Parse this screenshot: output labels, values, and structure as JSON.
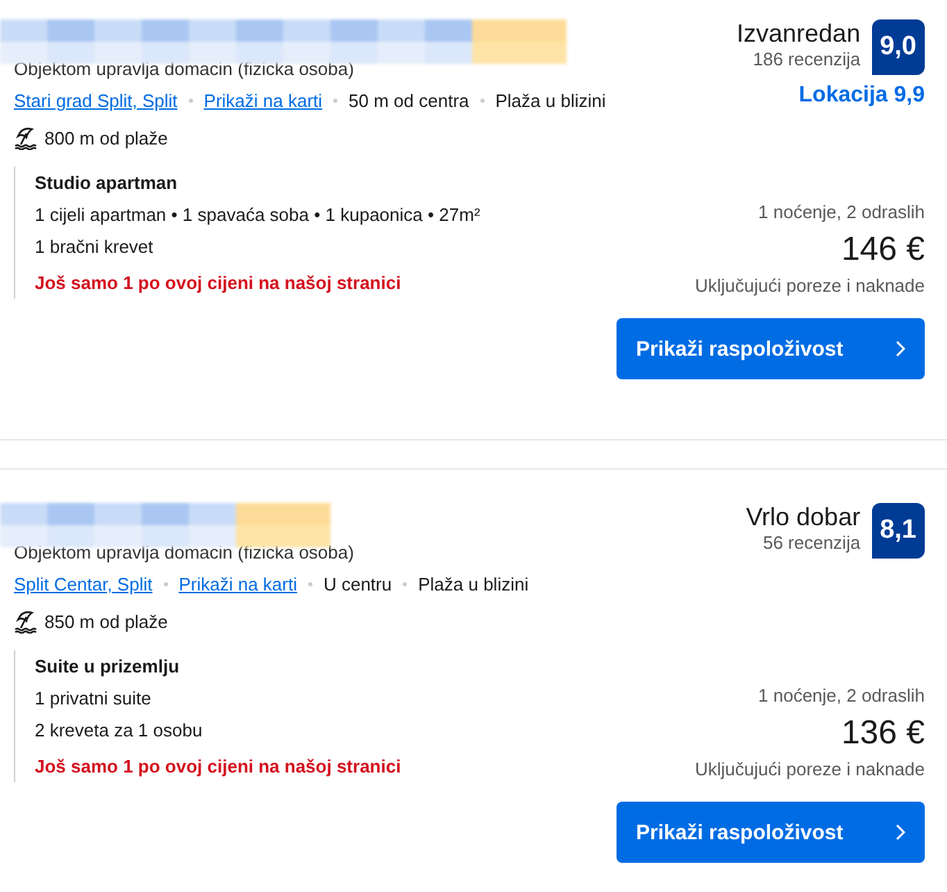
{
  "listings": [
    {
      "host": "Objektom upravlja domacin (fizicka osoba)",
      "rating_word": "Izvanredan",
      "reviews": "186 recenzija",
      "score": "9,0",
      "location_score": "Lokacija 9,9",
      "details": [
        {
          "kind": "link",
          "text": "Stari grad Split, Split"
        },
        {
          "kind": "link",
          "text": "Prikaži na karti"
        },
        {
          "kind": "plain",
          "text": "50 m od centra"
        },
        {
          "kind": "plain",
          "text": "Plaža u blizini"
        }
      ],
      "beach": "800 m od plaže",
      "room": "Studio apartman",
      "room_lines": [
        "1 cijeli apartman • 1 spavaća soba • 1 kupaonica • 27m²",
        "1 bračni krevet"
      ],
      "scarcity": "Još samo 1 po ovoj cijeni na našoj stranici",
      "stay": "1 noćenje, 2 odraslih",
      "price": "146 €",
      "taxes": "Uključujući poreze i naknade",
      "button": "Prikaži raspoloživost"
    },
    {
      "host": "Objektom upravlja domacin (fizicka osoba)",
      "rating_word": "Vrlo dobar",
      "reviews": "56 recenzija",
      "score": "8,1",
      "details": [
        {
          "kind": "link",
          "text": "Split Centar, Split"
        },
        {
          "kind": "link",
          "text": "Prikaži na karti"
        },
        {
          "kind": "plain",
          "text": "U centru"
        },
        {
          "kind": "plain",
          "text": "Plaža u blizini"
        }
      ],
      "beach": "850 m od plaže",
      "room": "Suite u prizemlju",
      "room_lines": [
        "1 privatni suite",
        "2 kreveta za 1 osobu"
      ],
      "scarcity": "Još samo 1 po ovoj cijeni na našoj stranici",
      "stay": "1 noćenje, 2 odraslih",
      "price": "136 €",
      "taxes": "Uključujući poreze i naknade",
      "button": "Prikaži raspoloživost"
    }
  ]
}
